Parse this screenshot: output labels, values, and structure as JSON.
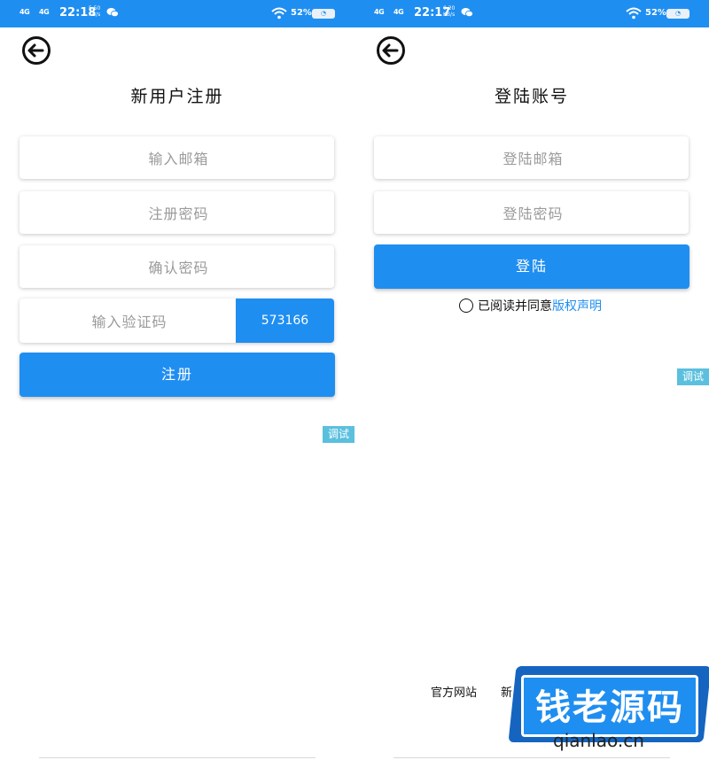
{
  "status_left": {
    "signal1": "4G",
    "signal2": "4G",
    "time": "22:18",
    "speed_value": "5.50",
    "speed_unit": "KB/s",
    "battery": "52%"
  },
  "status_right": {
    "signal1": "4G",
    "signal2": "4G",
    "time": "22:17",
    "speed_value": "0.20",
    "speed_unit": "KB/s",
    "battery": "52%"
  },
  "register": {
    "title": "新用户注册",
    "email_placeholder": "输入邮箱",
    "password_placeholder": "注册密码",
    "confirm_placeholder": "确认密码",
    "captcha_placeholder": "输入验证码",
    "captcha_code": "573166",
    "submit_label": "注册",
    "debug_label": "调试"
  },
  "login": {
    "title": "登陆账号",
    "email_placeholder": "登陆邮箱",
    "password_placeholder": "登陆密码",
    "submit_label": "登陆",
    "agree_text": "已阅读并同意",
    "agree_link": "版权声明",
    "debug_label": "调试",
    "footer_official": "官方网站",
    "footer_new": "新"
  },
  "watermark": {
    "title": "钱老源码",
    "site": "qianlao.cn"
  },
  "colors": {
    "primary": "#1f8ef1",
    "debug": "#5bc0de"
  },
  "icons": [
    "back-arrow-icon",
    "wifi-icon",
    "chat-icon",
    "battery-icon"
  ]
}
